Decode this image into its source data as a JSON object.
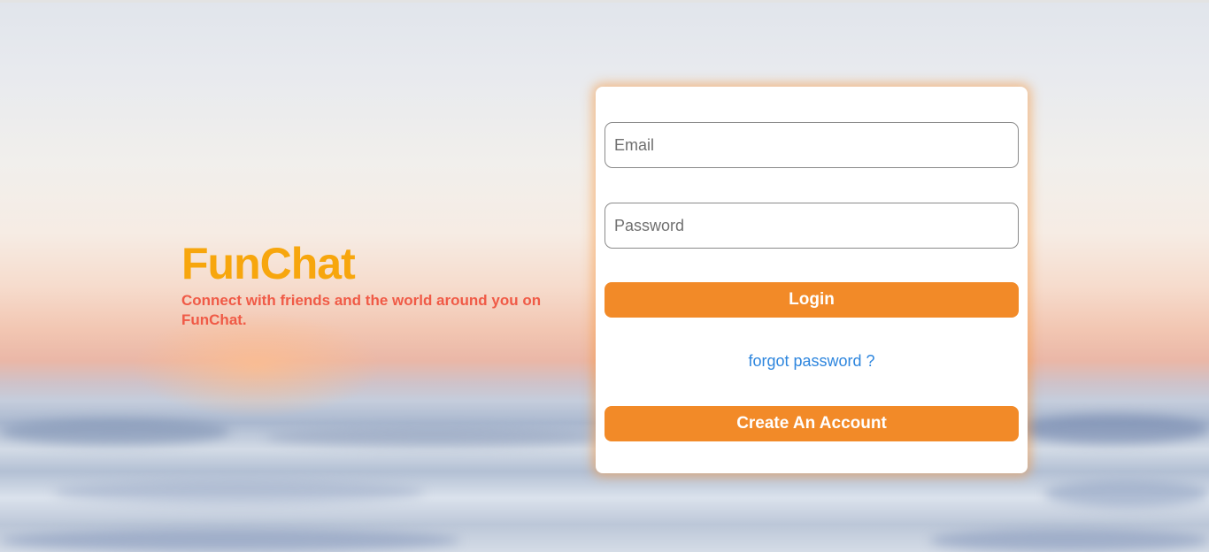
{
  "brand": {
    "title": "FunChat",
    "tagline": "Connect with friends and the world around you on FunChat."
  },
  "login_form": {
    "email_placeholder": "Email",
    "password_placeholder": "Password",
    "login_label": "Login",
    "forgot_label": "forgot password ?",
    "create_label": "Create An Account"
  },
  "colors": {
    "brand_title": "#f7a60d",
    "tagline": "#f05a46",
    "button": "#f28a28",
    "link": "#2e86de"
  }
}
